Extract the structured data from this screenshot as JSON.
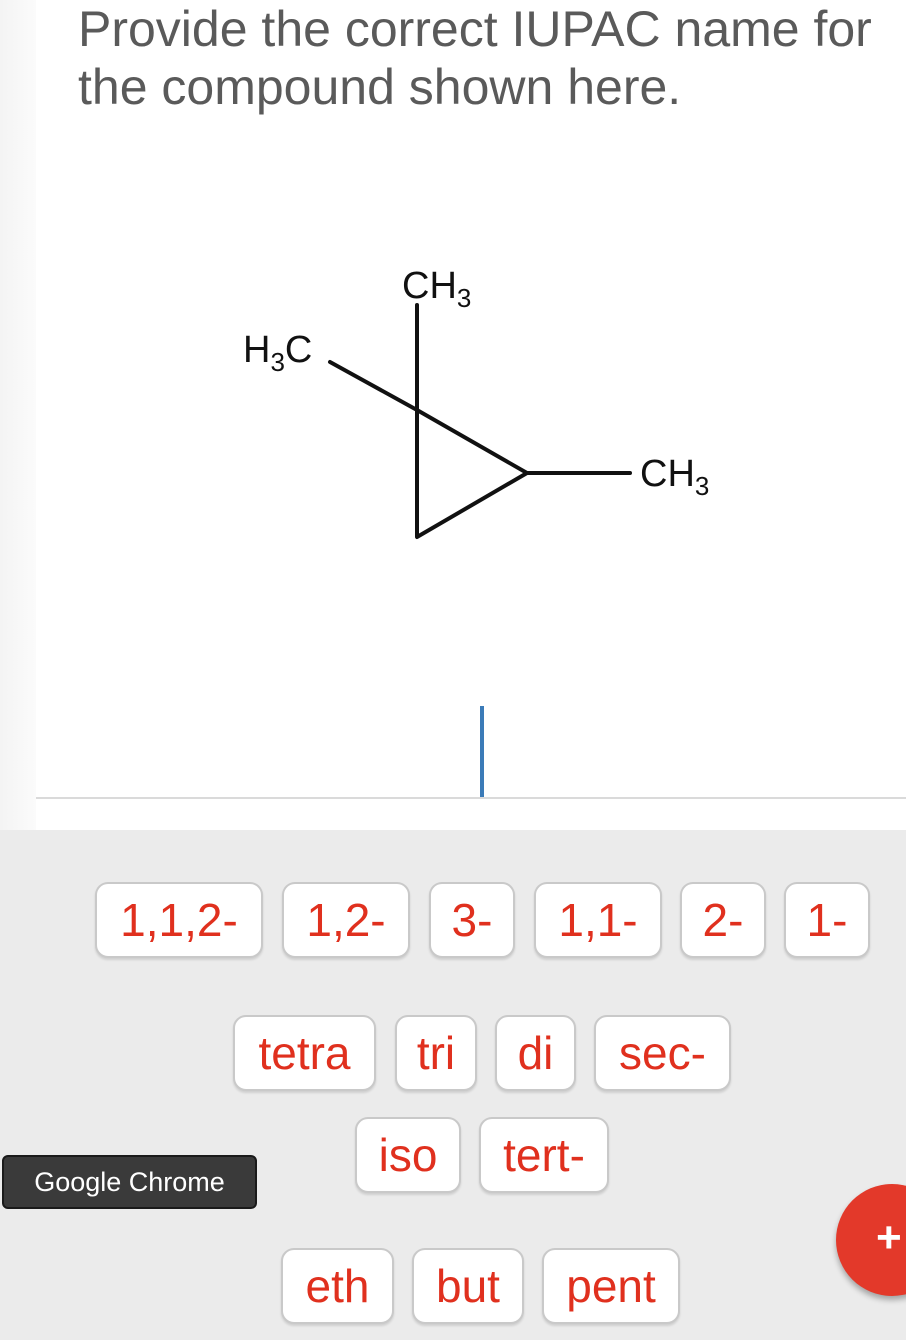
{
  "question": {
    "line1": "Provide the correct IUPAC name for",
    "line2": "the compound shown here."
  },
  "molecule": {
    "labels": {
      "top_ch3": "CH",
      "top_ch3_sub": "3",
      "left_h3c_h": "H",
      "left_h3c_sub": "3",
      "left_h3c_c": "C",
      "right_ch3": "CH",
      "right_ch3_sub": "3"
    }
  },
  "keyboard": {
    "locants": [
      "1,1,2-",
      "1,2-",
      "3-",
      "1,1-",
      "2-",
      "1-"
    ],
    "multipliers": [
      "tetra",
      "tri",
      "di",
      "sec-"
    ],
    "branching": [
      "iso",
      "tert-"
    ],
    "stems": [
      "eth",
      "but",
      "pent"
    ]
  },
  "tooltip": {
    "text": "Google Chrome"
  },
  "fab": {
    "icon": "plus-icon",
    "symbol": "+"
  },
  "colors": {
    "key_text": "#e0301e",
    "fab": "#e3392a",
    "cursor": "#3b7bb8"
  }
}
